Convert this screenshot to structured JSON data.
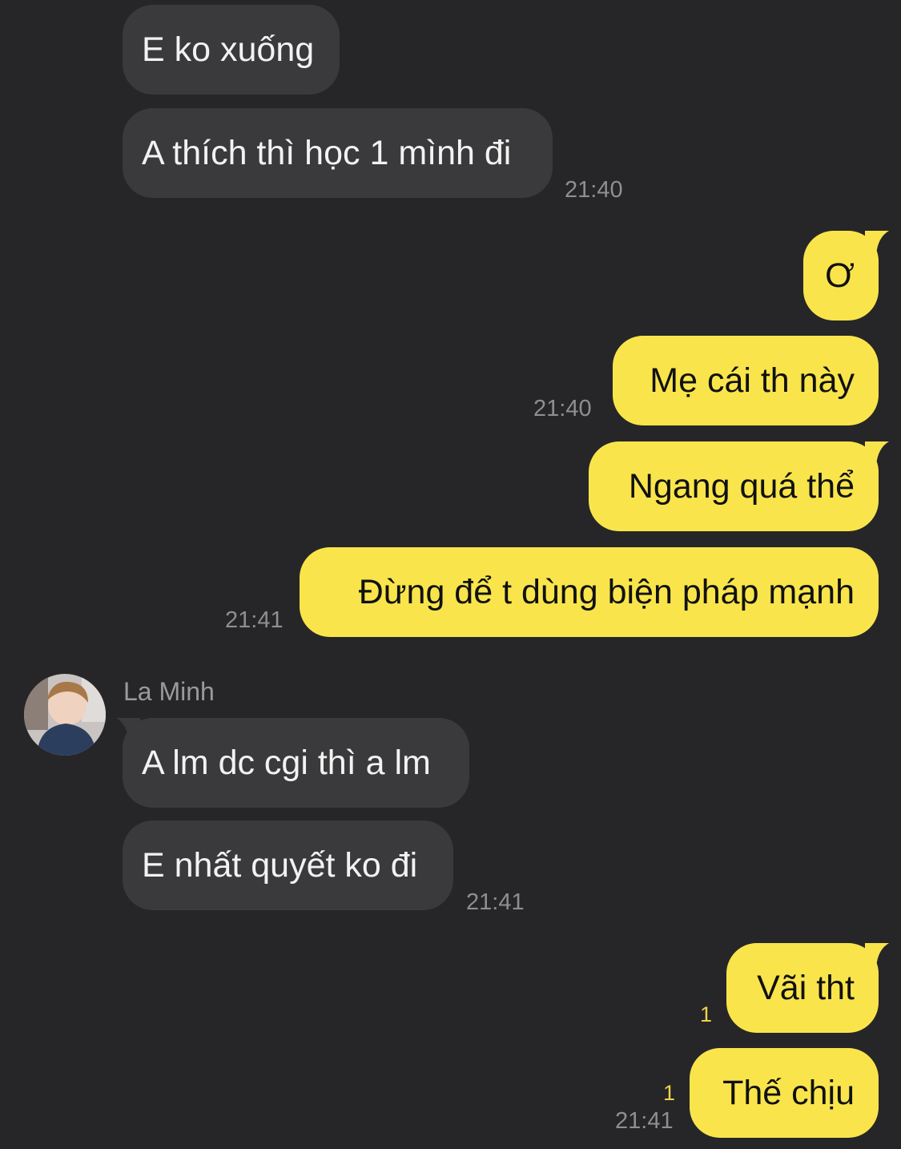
{
  "messages": {
    "in1": "E ko xuống",
    "in2": "A thích thì học 1 mình đi",
    "out1": "Ơ",
    "out2": "Mẹ cái th này",
    "out3": "Ngang quá thể",
    "out4": "Đừng để t dùng biện pháp mạnh",
    "in3": "A lm dc cgi thì a lm",
    "in4": "E nhất quyết ko đi",
    "out5": "Vãi tht",
    "out6": "Thế chịu"
  },
  "times": {
    "t1": "21:40",
    "t2": "21:40",
    "t3": "21:41",
    "t4": "21:41",
    "t5": "21:41"
  },
  "unread": {
    "u1": "1",
    "u2": "1"
  },
  "sender": {
    "name": "La Minh"
  },
  "colors": {
    "background": "#262628",
    "incoming_bubble": "#3a3a3c",
    "outgoing_bubble": "#f9e54b",
    "timestamp": "#8e8e93",
    "unread_count": "#f3d14a"
  }
}
